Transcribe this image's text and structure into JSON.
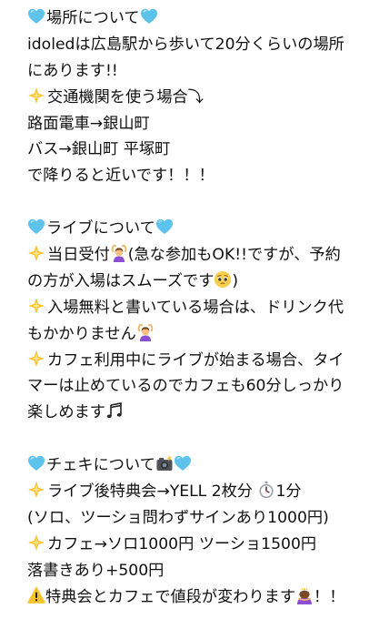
{
  "sections": [
    {
      "lines": [
        {
          "parts": [
            {
              "icon": "blue-heart-icon"
            },
            {
              "text": "場所について"
            },
            {
              "icon": "blue-heart-icon"
            }
          ]
        },
        {
          "parts": [
            {
              "text": "idoledは広島駅から歩いて20分くらいの場所"
            }
          ]
        },
        {
          "parts": [
            {
              "text": "にあります!!"
            }
          ]
        },
        {
          "parts": [
            {
              "icon": "sparkle-star-icon"
            },
            {
              "text": "交通機関を使う場合⤵"
            }
          ]
        },
        {
          "parts": [
            {
              "text": "路面電車→銀山町"
            }
          ]
        },
        {
          "parts": [
            {
              "text": "バス→銀山町 平塚町"
            }
          ]
        },
        {
          "parts": [
            {
              "text": "で降りると近いです！！！"
            }
          ]
        }
      ]
    },
    {
      "lines": [
        {
          "parts": [
            {
              "icon": "blue-heart-icon"
            },
            {
              "text": "ライブについて"
            },
            {
              "icon": "blue-heart-icon"
            }
          ]
        },
        {
          "parts": [
            {
              "icon": "sparkle-star-icon"
            },
            {
              "text": "当日受付"
            },
            {
              "icon": "person-gesturing-ok-icon"
            },
            {
              "text": "(急な参加もOK!!ですが、予約"
            }
          ]
        },
        {
          "parts": [
            {
              "text": "の方が入場はスムーズです"
            },
            {
              "icon": "pleading-face-icon"
            },
            {
              "text": ")"
            }
          ]
        },
        {
          "parts": [
            {
              "icon": "sparkle-star-icon"
            },
            {
              "text": "入場無料と書いている場合は、ドリンク代"
            }
          ]
        },
        {
          "parts": [
            {
              "text": "もかかりません"
            },
            {
              "icon": "person-gesturing-ok-icon"
            }
          ]
        },
        {
          "parts": [
            {
              "icon": "sparkle-star-icon"
            },
            {
              "text": "カフェ利用中にライブが始まる場合、タイ"
            }
          ]
        },
        {
          "parts": [
            {
              "text": "マーは止めているのでカフェも60分しっかり"
            }
          ]
        },
        {
          "parts": [
            {
              "text": "楽しめます"
            },
            {
              "icon": "musical-notes-icon"
            }
          ]
        }
      ]
    },
    {
      "lines": [
        {
          "parts": [
            {
              "icon": "blue-heart-icon"
            },
            {
              "text": "チェキについて"
            },
            {
              "icon": "camera-flash-icon"
            },
            {
              "icon": "blue-heart-icon"
            }
          ]
        },
        {
          "parts": [
            {
              "icon": "sparkle-star-icon"
            },
            {
              "text": "ライブ後特典会→YELL 2枚分 "
            },
            {
              "icon": "stopwatch-icon"
            },
            {
              "text": "1分"
            }
          ]
        },
        {
          "parts": [
            {
              "text": "(ソロ、ツーショ問わずサインあり1000円)"
            }
          ]
        },
        {
          "parts": [
            {
              "icon": "sparkle-star-icon"
            },
            {
              "text": "カフェ→ソロ1000円 ツーショ1500円"
            }
          ]
        },
        {
          "parts": [
            {
              "text": "落書きあり+500円"
            }
          ]
        },
        {
          "parts": [
            {
              "icon": "warning-icon"
            },
            {
              "text": "特典会とカフェで値段が変わります"
            },
            {
              "icon": "person-bowing-icon"
            },
            {
              "text": "！！"
            }
          ]
        }
      ]
    }
  ],
  "colors": {
    "background": "#ffffff",
    "text": "#111111",
    "heart_blue": "#5ec3ec",
    "sparkle_yellow": "#f7c531",
    "warning_yellow": "#f5c22c"
  }
}
